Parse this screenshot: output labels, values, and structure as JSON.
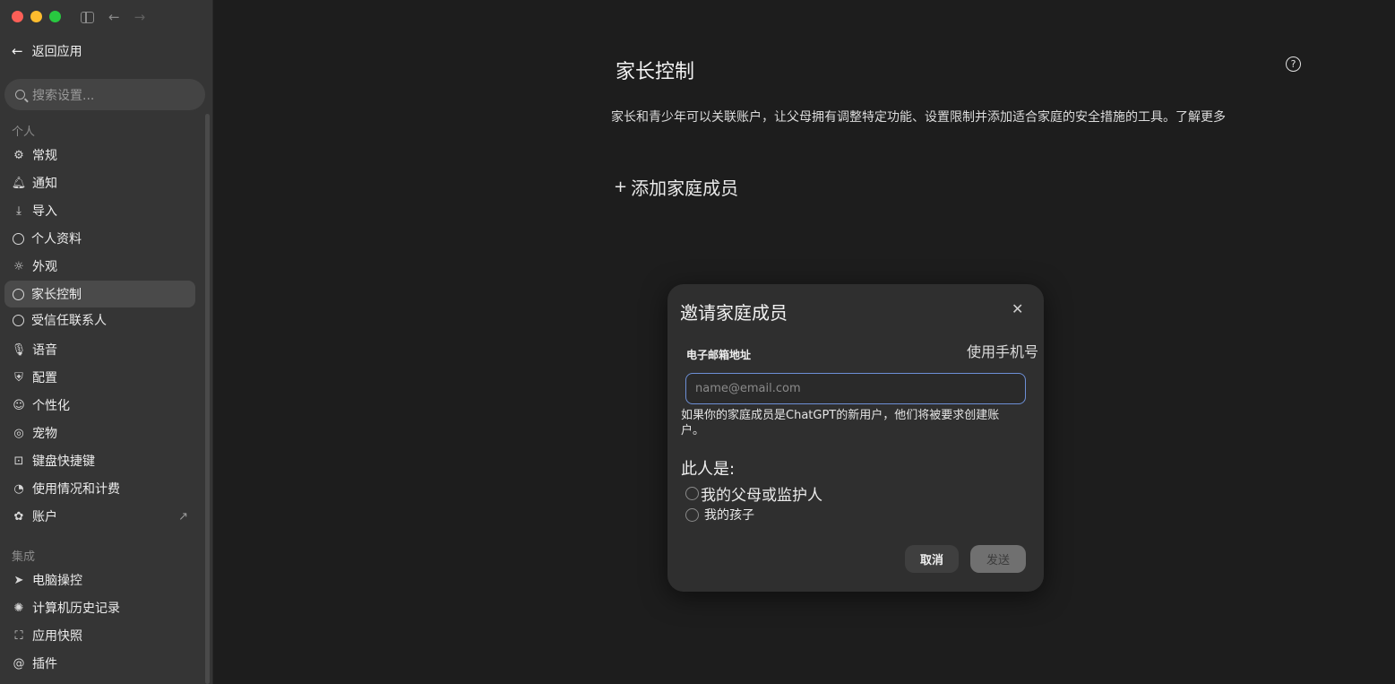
{
  "window": {
    "controls": [
      "close",
      "minimize",
      "maximize"
    ],
    "toolbar_icons": [
      "sidebar-toggle-icon",
      "back-arrow-icon",
      "forward-arrow-icon"
    ]
  },
  "sidebar": {
    "back_label": "返回应用",
    "search_placeholder": "搜索设置...",
    "section_personal": "个人",
    "items": [
      {
        "label": "常规",
        "icon": "gear-icon"
      },
      {
        "label": "通知",
        "icon": "bell-icon"
      },
      {
        "label": "导入",
        "icon": "download-icon"
      },
      {
        "label": "个人资料",
        "icon": "profile-icon"
      },
      {
        "label": "外观",
        "icon": "sun-icon"
      },
      {
        "label": "家长控制",
        "icon": "profile-icon",
        "active": true
      },
      {
        "label": "受信任联系人",
        "icon": "profile-icon"
      },
      {
        "label": "语音",
        "icon": "mic-icon"
      },
      {
        "label": "配置",
        "icon": "shield-icon"
      },
      {
        "label": "个性化",
        "icon": "smile-icon"
      },
      {
        "label": "宠物",
        "icon": "egg-icon"
      },
      {
        "label": "键盘快捷键",
        "icon": "keyboard-icon"
      },
      {
        "label": "使用情况和计费",
        "icon": "gauge-icon"
      },
      {
        "label": "账户",
        "icon": "openai-icon"
      }
    ],
    "section_integrations": "集成",
    "integration_items": [
      {
        "label": "电脑操控",
        "icon": "cursor-icon"
      },
      {
        "label": "计算机历史记录",
        "icon": "sparkle-icon"
      },
      {
        "label": "应用快照",
        "icon": "frame-icon"
      },
      {
        "label": "插件",
        "icon": "at-icon"
      }
    ]
  },
  "main": {
    "title": "家长控制",
    "description": "家长和青少年可以关联账户，让父母拥有调整特定功能、设置限制并添加适合家庭的安全措施的工具。了解更多",
    "add_member": "添加家庭成员"
  },
  "dialog": {
    "title": "邀请家庭成员",
    "email_label": "电子邮箱地址",
    "use_phone": "使用手机号",
    "email_placeholder": "name@email.com",
    "email_value": "",
    "hint": "如果你的家庭成员是ChatGPT的新用户，他们将被要求创建账户。",
    "person_label": "此人是:",
    "options": [
      "我的父母或监护人",
      "我的孩子"
    ],
    "cancel": "取消",
    "send": "发送"
  }
}
